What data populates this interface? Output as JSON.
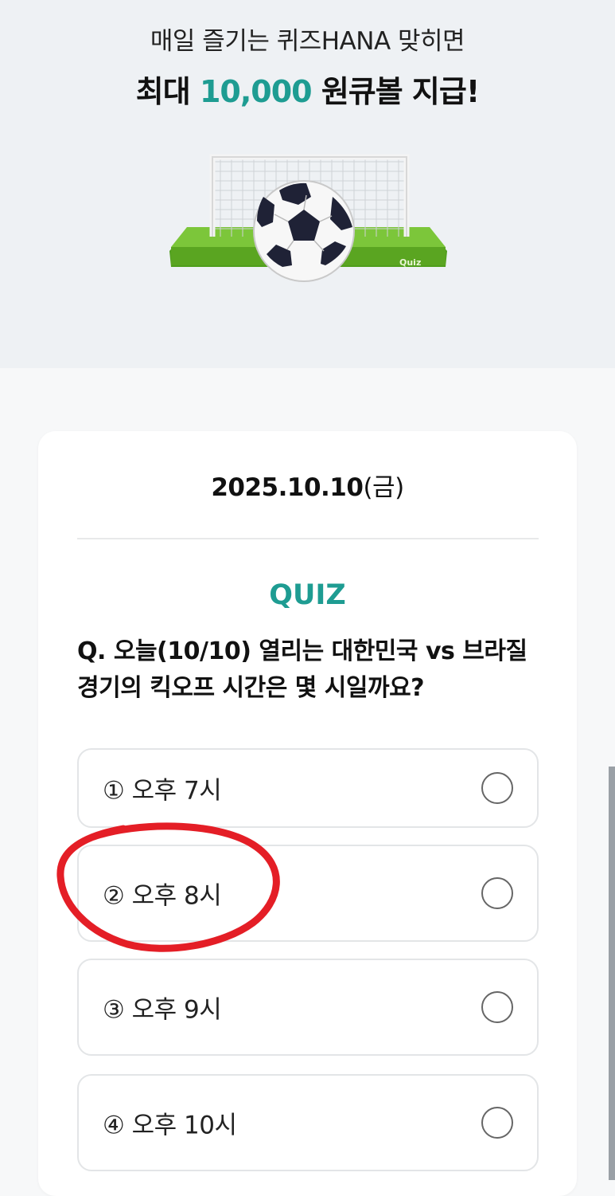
{
  "hero": {
    "subtitle": "매일 즐기는 퀴즈HANA 맞히면",
    "title_prefix": "최대 ",
    "title_amount": "10,000",
    "title_suffix": " 원큐볼 지급!",
    "image_label": "Quiz"
  },
  "quiz": {
    "date": "2025.10.10",
    "day": "(금)",
    "label": "QUIZ",
    "question": "Q. 오늘(10/10) 열리는 대한민국 vs 브라질 경기의 킥오프 시간은 몇 시일까요?",
    "options": [
      {
        "label": "① 오후 7시"
      },
      {
        "label": "② 오후 8시"
      },
      {
        "label": "③ 오후 9시"
      },
      {
        "label": "④ 오후 10시"
      }
    ]
  },
  "colors": {
    "accent": "#1e9c92",
    "annotation": "#e41e26",
    "hero_bg": "#eef1f4"
  }
}
